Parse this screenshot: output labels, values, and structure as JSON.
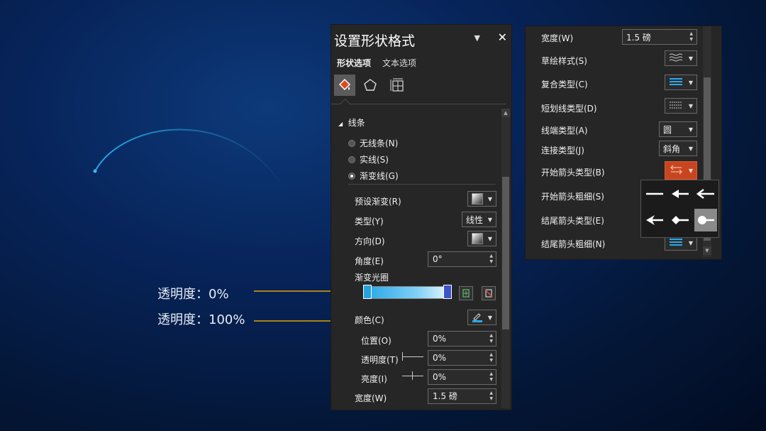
{
  "colors": {
    "background": "#041a40",
    "panel": "#262626",
    "accent_blue": "#2aa8e8",
    "annotation_line": "#e0a200",
    "active_button": "#c9451f"
  },
  "annotations": {
    "transparency_0": "透明度：0%",
    "transparency_100": "透明度：100%"
  },
  "format_panel": {
    "title": "设置形状格式",
    "dropdown_icon": "chevron-down-icon",
    "close_icon": "close-icon",
    "tabs": [
      "形状选项",
      "文本选项"
    ],
    "icons": [
      "fill-line-icon",
      "effects-pentagon-icon",
      "size-properties-icon"
    ],
    "section": "线条",
    "line_options": [
      "无线条(N)",
      "实线(S)",
      "渐变线(G)"
    ],
    "selected_line_option": "渐变线(G)",
    "preset_gradient_label": "预设渐变(R)",
    "type_label": "类型(Y)",
    "type_value": "线性",
    "direction_label": "方向(D)",
    "angle_label": "角度(E)",
    "angle_value": "0°",
    "gradient_stops_label": "渐变光圈",
    "color_label": "颜色(C)",
    "position_label": "位置(O)",
    "position_value": "0%",
    "transparency_label": "透明度(T)",
    "transparency_value": "0%",
    "brightness_label": "亮度(I)",
    "brightness_value": "0%",
    "width_label": "宽度(W)",
    "width_value": "1.5 磅"
  },
  "line_panel": {
    "width_label": "宽度(W)",
    "width_value": "1.5 磅",
    "sketch_style_label": "草绘样式(S)",
    "compound_type_label": "复合类型(C)",
    "dash_type_label": "短划线类型(D)",
    "cap_type_label": "线端类型(A)",
    "cap_type_value": "圆",
    "join_type_label": "连接类型(J)",
    "join_type_value": "斜角",
    "begin_arrow_type_label": "开始箭头类型(B)",
    "begin_arrow_size_label": "开始箭头粗细(S)",
    "end_arrow_type_label": "结尾箭头类型(E)",
    "end_arrow_size_label": "结尾箭头粗细(N)",
    "arrow_options": [
      "no-arrow-icon",
      "arrow-icon",
      "open-arrow-icon",
      "stealth-arrow-icon",
      "diamond-arrow-icon",
      "oval-arrow-icon"
    ],
    "selected_arrow": "oval-arrow-icon"
  }
}
